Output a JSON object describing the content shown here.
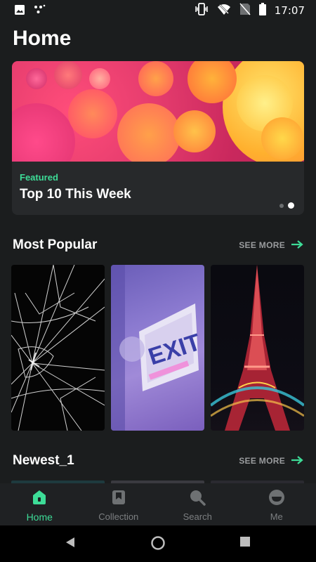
{
  "status_bar": {
    "time": "17:07",
    "icons": [
      "image-icon",
      "dots-icon",
      "vibrate-icon",
      "wifi-off-icon",
      "no-sim-icon",
      "battery-icon"
    ]
  },
  "page": {
    "title": "Home"
  },
  "featured": {
    "badge": "Featured",
    "title": "Top 10 This Week",
    "pages_total": 2,
    "page_active": 2,
    "image": "colorful-oil-bubbles"
  },
  "sections": {
    "most_popular": {
      "title": "Most Popular",
      "see_more": "SEE MORE",
      "items": [
        "cracked-glass-wallpaper",
        "exit-sign-wallpaper",
        "eiffel-tower-night-wallpaper"
      ]
    },
    "newest": {
      "title": "Newest_1",
      "see_more": "SEE MORE"
    }
  },
  "bottom_nav": {
    "items": [
      {
        "label": "Home",
        "icon": "home-icon",
        "active": true
      },
      {
        "label": "Collection",
        "icon": "bookmark-icon",
        "active": false
      },
      {
        "label": "Search",
        "icon": "search-icon",
        "active": false
      },
      {
        "label": "Me",
        "icon": "profile-icon",
        "active": false
      }
    ]
  },
  "colors": {
    "accent": "#3ddc97",
    "background": "#1b1d1e",
    "card": "#27292b",
    "muted": "#7c7f81"
  }
}
